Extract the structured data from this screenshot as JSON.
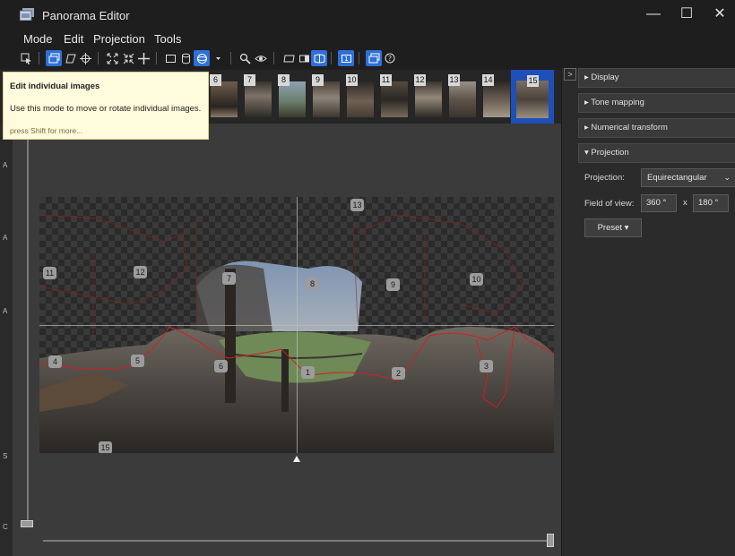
{
  "window": {
    "title": "Panorama Editor",
    "minimize_glyph": "—",
    "maximize_glyph": "☐",
    "close_glyph": "✕"
  },
  "menu": {
    "mode": "Mode",
    "edit": "Edit",
    "projection": "Projection",
    "tools": "Tools"
  },
  "toolbar": {
    "buttons": [
      "select-tool-icon",
      "edit-images-icon",
      "free-rotate-icon",
      "move-center-icon",
      "fit-icon",
      "shrink-icon",
      "center-cross-icon",
      "rectilinear-icon",
      "cylindrical-icon",
      "spherical-icon",
      "dropdown-arrow-icon",
      "zoom-icon",
      "preview-eye-icon",
      "crop-left-icon",
      "crop-center-icon",
      "crop-auto-icon",
      "show-labels-icon",
      "overlay-icon",
      "help-icon"
    ],
    "active": [
      "edit-images-icon",
      "spherical-icon",
      "crop-auto-icon",
      "show-labels-icon",
      "overlay-icon"
    ]
  },
  "thumbnails": [
    "6",
    "7",
    "8",
    "9",
    "10",
    "11",
    "12",
    "13",
    "14",
    "15"
  ],
  "selected_thumbnail": "15",
  "tooltip": {
    "title": "Edit individual images",
    "body": "Use this mode to move or rotate individual images.",
    "hint": "press Shift for more..."
  },
  "panorama": {
    "labels": [
      "13",
      "11",
      "12",
      "7",
      "8",
      "9",
      "10",
      "4",
      "5",
      "6",
      "1",
      "2",
      "3",
      "15"
    ]
  },
  "side_edge_letters": [
    "A",
    "A",
    "A",
    "S",
    "C"
  ],
  "right_panel": {
    "collapse_glyph": ">",
    "sections": {
      "display": "▸ Display",
      "tone_mapping": "▸ Tone mapping",
      "numerical_transform": "▸ Numerical transform",
      "projection": "▾ Projection"
    },
    "projection_label": "Projection:",
    "projection_value": "Equirectangular",
    "fov_label": "Field of view:",
    "fov_h": "360 °",
    "fov_x": "x",
    "fov_v": "180 °",
    "preset_label": "Preset ▾"
  },
  "colors": {
    "accent": "#2f6fd8",
    "selected_thumb": "#1f4fb8",
    "seam": "#d02020",
    "tooltip_bg": "#fffbdc"
  }
}
